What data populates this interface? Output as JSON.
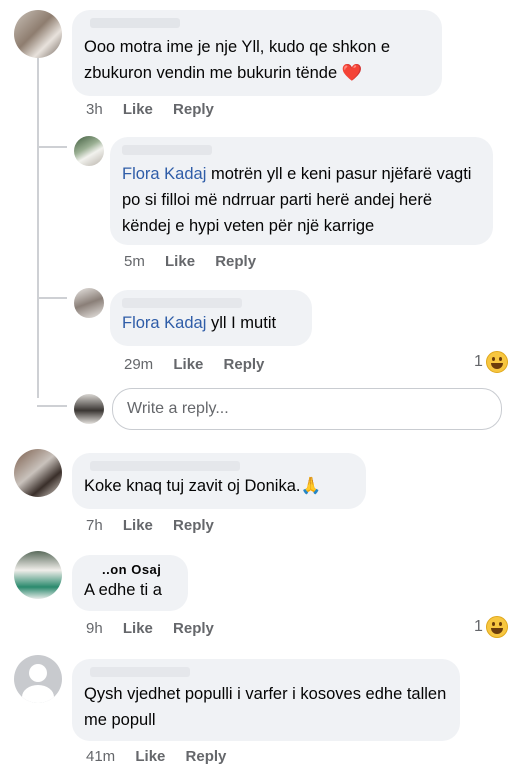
{
  "actions": {
    "like": "Like",
    "reply": "Reply"
  },
  "comments": [
    {
      "name_fragment": "",
      "text": "Ooo motra ime je nje Yll, kudo qe shkon e zbukuron vendin me bukurin tënde",
      "emoji": "❤️",
      "time": "3h",
      "replies": [
        {
          "name_fragment": "",
          "mention": "Flora Kadaj",
          "text": " motrën yll e keni pasur njëfarë vagti po si filloi më ndrruar parti herë andej herë këndej e hypi veten për një karrige",
          "time": "5m"
        },
        {
          "name_fragment": "",
          "mention": "Flora Kadaj",
          "text": " yll I mutit",
          "time": "29m",
          "reaction_count": "1"
        }
      ],
      "reply_placeholder": "Write a reply..."
    },
    {
      "name_fragment": "",
      "text": "Koke knaq tuj zavit oj Donika.",
      "emoji": "🙏",
      "time": "7h"
    },
    {
      "name_fragment": "..on Osaj",
      "text": "A edhe ti a",
      "time": "9h",
      "reaction_count": "1"
    },
    {
      "name_fragment": "",
      "text": "Qysh vjedhet populli i varfer i kosoves edhe tallen me popull",
      "time": "41m"
    }
  ]
}
